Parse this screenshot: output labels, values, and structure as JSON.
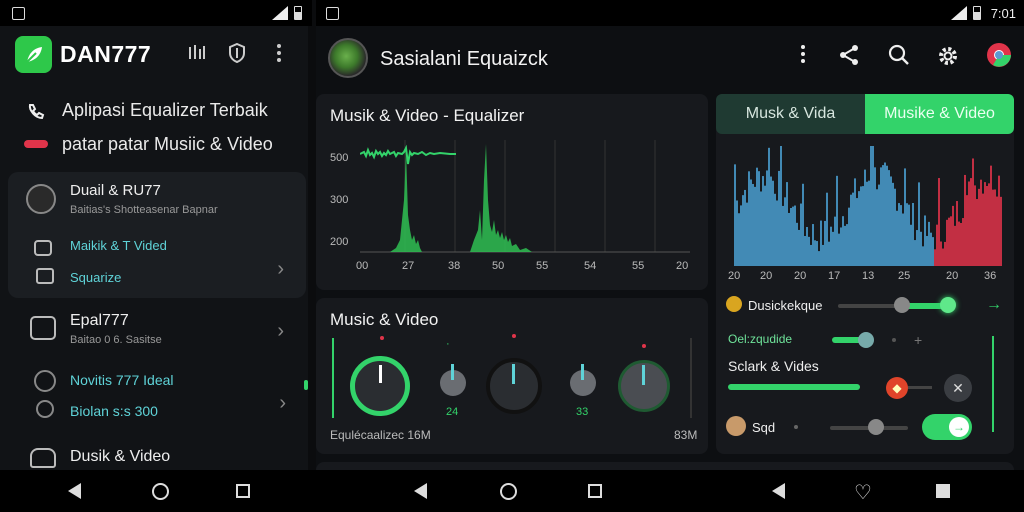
{
  "status": {
    "time": "7:01"
  },
  "left": {
    "brand": "DAN777",
    "promo_line1": "Aplipasi Equalizer Terbaik",
    "promo_line2": "patar patar Musiic & Video",
    "items": [
      {
        "title": "Duail & RU77",
        "sub": "Baitias's Shotteasenar Bapnar",
        "link1": "Maikik & T Vided",
        "link2": "Squarize"
      },
      {
        "title": "Epal777",
        "sub": "Baitao 0 6. Sasitse",
        "link1": "Novitis 777 Ideal",
        "link2": "Biolan s:s 300"
      },
      {
        "title": "Dusik & Video"
      }
    ]
  },
  "main": {
    "app_title": "Sasialani Equaizck",
    "card1": {
      "title": "Musik & Video - Equalizer",
      "yticks": [
        "500",
        "300",
        "200"
      ],
      "xticks": [
        "00",
        "27",
        "38",
        "50",
        "55",
        "54",
        "55",
        "20"
      ]
    },
    "card2": {
      "title": "Music & Video",
      "footer_left": "Equlécaalizec 16M",
      "footer_right": "83M",
      "labels": [
        "24",
        "33"
      ]
    },
    "tabs": [
      "Musk & Vida",
      "Musike & Video"
    ],
    "spectrum_ticks": [
      "20",
      "20",
      "20",
      "17",
      "13",
      "25",
      "20",
      "36"
    ],
    "rows": [
      {
        "label": "Dusickekque"
      },
      {
        "label": "Oel:zqudide"
      },
      {
        "label": "Sclark & Vides"
      },
      {
        "label": "Sqd"
      }
    ]
  },
  "colors": {
    "accent": "#33d36a",
    "spectrum_blue": "#4a9fd0",
    "spectrum_red": "#e0344a"
  }
}
